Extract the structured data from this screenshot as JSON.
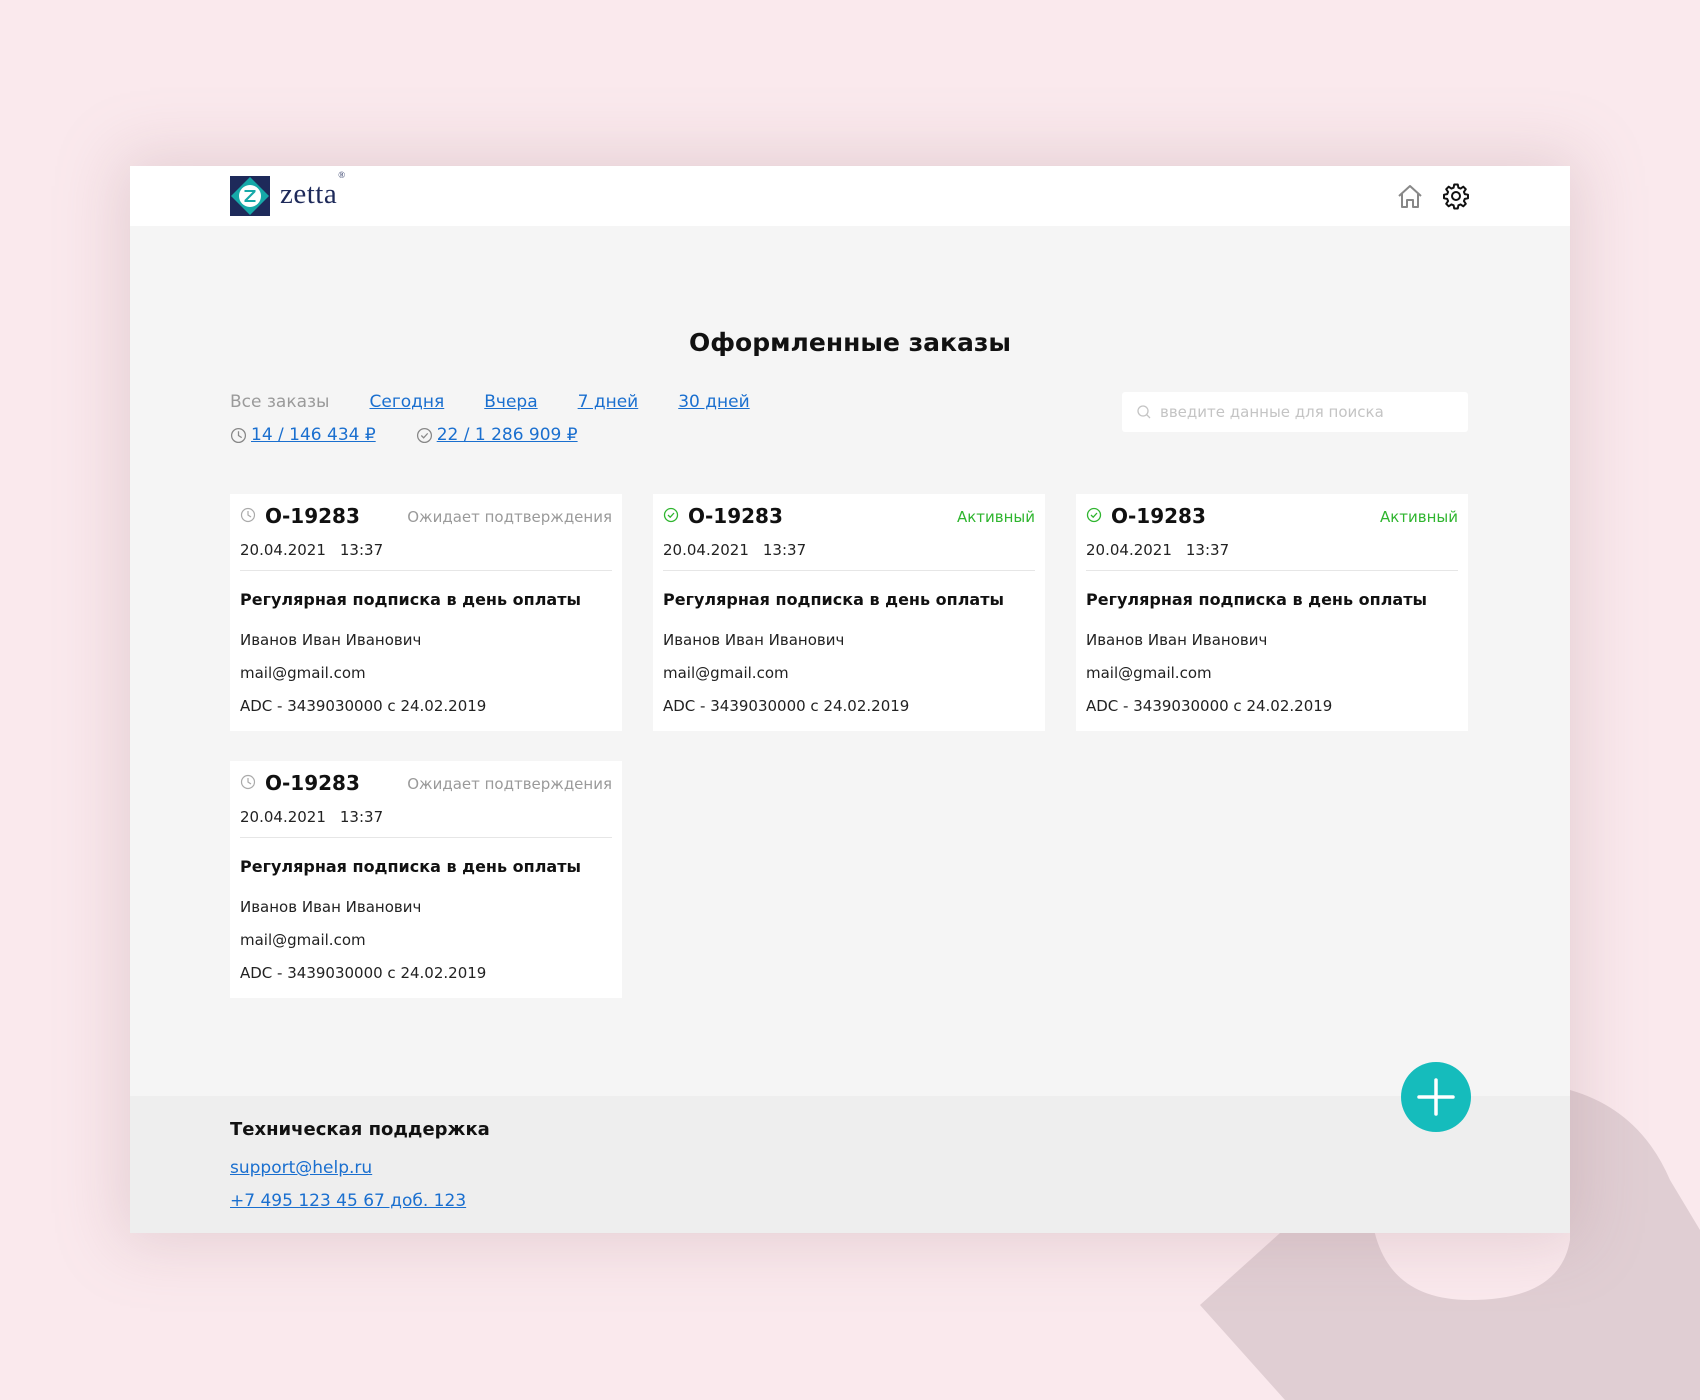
{
  "brand": {
    "name": "zetta",
    "trademark": "®"
  },
  "header": {
    "icons": [
      "home-icon",
      "gear-icon"
    ]
  },
  "page": {
    "title": "Оформленные заказы"
  },
  "filters": {
    "all": "Все заказы",
    "today": "Сегодня",
    "yesterday": "Вчера",
    "week": "7 дней",
    "month": "30 дней"
  },
  "stats": {
    "pending": "14 / 146 434 ₽",
    "completed": "22 / 1 286 909 ₽"
  },
  "search": {
    "placeholder": "введите данные для поиска"
  },
  "orders": [
    {
      "id": "О-19283",
      "status": "Ожидает подтверждения",
      "status_type": "pending",
      "date": "20.04.2021",
      "time": "13:37",
      "title": "Регулярная подписка в день оплаты",
      "name": "Иванов Иван Иванович",
      "email": "mail@gmail.com",
      "account": "ADC - 3439030000 с 24.02.2019"
    },
    {
      "id": "О-19283",
      "status": "Активный",
      "status_type": "active",
      "date": "20.04.2021",
      "time": "13:37",
      "title": "Регулярная подписка в день оплаты",
      "name": "Иванов Иван Иванович",
      "email": "mail@gmail.com",
      "account": "ADC - 3439030000 с 24.02.2019"
    },
    {
      "id": "О-19283",
      "status": "Активный",
      "status_type": "active",
      "date": "20.04.2021",
      "time": "13:37",
      "title": "Регулярная подписка в день оплаты",
      "name": "Иванов Иван Иванович",
      "email": "mail@gmail.com",
      "account": "ADC - 3439030000 с 24.02.2019"
    },
    {
      "id": "О-19283",
      "status": "Ожидает подтверждения",
      "status_type": "pending",
      "date": "20.04.2021",
      "time": "13:37",
      "title": "Регулярная подписка в день оплаты",
      "name": "Иванов Иван Иванович",
      "email": "mail@gmail.com",
      "account": "ADC - 3439030000 с 24.02.2019"
    }
  ],
  "footer": {
    "title": "Техническая поддержка",
    "email": "support@help.ru",
    "phone": "+7 495 123 45 67 доб. 123"
  },
  "colors": {
    "background": "#fae9ed",
    "accent": "#15bcbc",
    "link": "#1a6fcf",
    "active": "#2fb52f",
    "pending": "#9a9a9a",
    "brand": "#1e2a5a"
  }
}
